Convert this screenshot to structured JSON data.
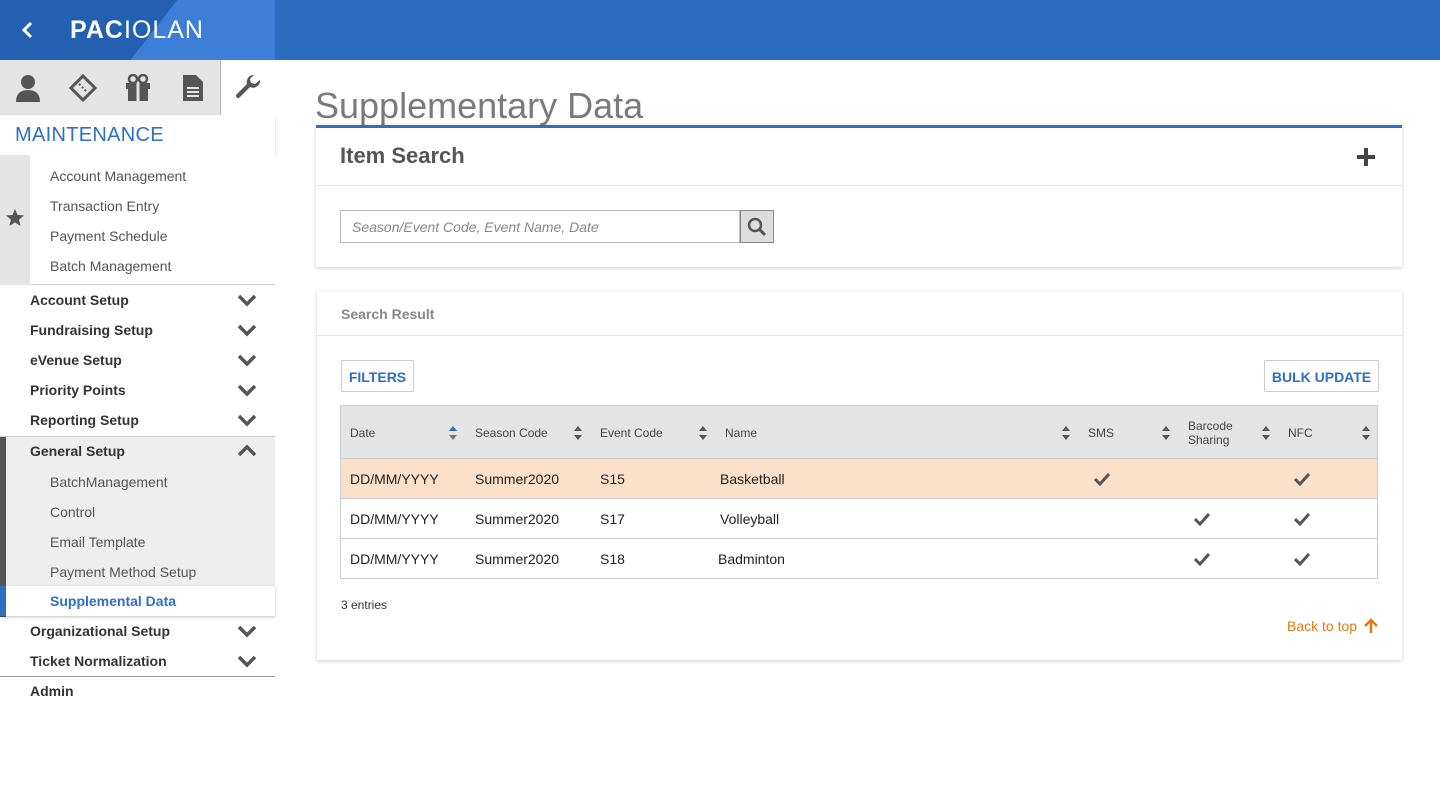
{
  "brand": {
    "logo_bold": "PAC",
    "logo_rest": "IOLAN"
  },
  "sidebar": {
    "section_title": "MAINTENANCE",
    "favorites": [
      "Account Management",
      "Transaction Entry",
      "Payment Schedule",
      "Batch Management"
    ],
    "menu": [
      {
        "label": "Account Setup"
      },
      {
        "label": "Fundraising Setup"
      },
      {
        "label": "eVenue Setup"
      },
      {
        "label": "Priority Points"
      },
      {
        "label": "Reporting Setup"
      }
    ],
    "general_setup": {
      "label": "General Setup",
      "children": [
        "BatchManagement",
        "Control",
        "Email Template",
        "Payment Method Setup"
      ],
      "selected": "Supplemental Data"
    },
    "menu_after": [
      {
        "label": "Organizational Setup"
      },
      {
        "label": "Ticket Normalization"
      }
    ],
    "admin": "Admin"
  },
  "main": {
    "title": "Supplementary Data",
    "item_search": {
      "title": "Item Search",
      "placeholder": "Season/Event Code, Event Name, Date"
    },
    "search_result": {
      "title": "Search Result",
      "filters_label": "FILTERS",
      "bulk_update_label": "BULK UPDATE",
      "columns": [
        "Date",
        "Season Code",
        "Event Code",
        "Name",
        "SMS",
        "Barcode Sharing",
        "NFC"
      ],
      "rows": [
        {
          "date": "DD/MM/YYYY",
          "season": "Summer2020",
          "event": "S15",
          "name": "Basketball",
          "sms": true,
          "barcode": false,
          "nfc": true
        },
        {
          "date": "DD/MM/YYYY",
          "season": "Summer2020",
          "event": "S17",
          "name": "Volleyball",
          "sms": false,
          "barcode": true,
          "nfc": true
        },
        {
          "date": "DD/MM/YYYY",
          "season": "Summer2020",
          "event": "S18",
          "name": "Badminton",
          "sms": false,
          "barcode": true,
          "nfc": true
        }
      ],
      "entries_text": "3 entries",
      "back_to_top": "Back to top"
    }
  },
  "colors": {
    "primary": "#2b6cbf",
    "accent_orange": "#e07a0e",
    "highlight_row": "#fbe1ca"
  }
}
